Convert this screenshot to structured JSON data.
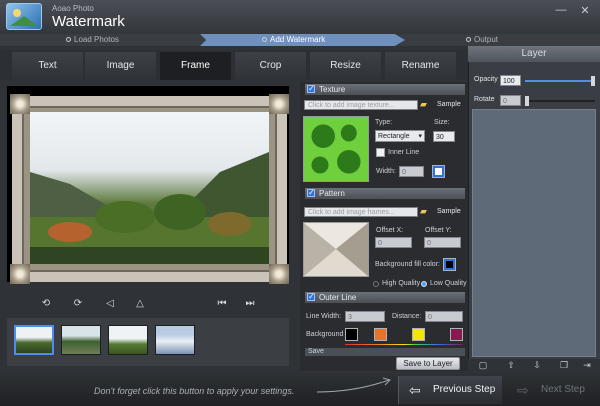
{
  "app": {
    "sub_title": "Aoao Photo",
    "title": "Watermark"
  },
  "window_controls": {
    "minimize": "—",
    "close": "✕"
  },
  "steps": [
    "Load Photos",
    "Add Watermark",
    "Output"
  ],
  "tabs": [
    "Text",
    "Image",
    "Frame",
    "Crop",
    "Resize",
    "Rename"
  ],
  "active_tab": "Frame",
  "preview_tools": {
    "rotate_left": "⟲",
    "rotate_right": "⟳",
    "flip_h": "◁",
    "flip_v": "△",
    "first": "⏮",
    "last": "⏭"
  },
  "texture": {
    "title": "Texture",
    "placeholder": "Click to add image texture...",
    "sample_label": "Sample",
    "type_label": "Type:",
    "type_value": "Rectangle",
    "size_label": "Size:",
    "size_value": "30",
    "inner_line_label": "Inner Line",
    "width_label": "Width:",
    "width_value": "0"
  },
  "pattern": {
    "title": "Pattern",
    "placeholder": "Click to add image frames...",
    "sample_label": "Sample",
    "offset_x_label": "Offset X:",
    "offset_x_value": "0",
    "offset_y_label": "Offset Y:",
    "offset_y_value": "0",
    "bg_fill_label": "Background fill color:",
    "high_quality_label": "High Quality",
    "low_quality_label": "Low Quality"
  },
  "outer_line": {
    "title": "Outer Line",
    "line_width_label": "Line Width:",
    "line_width_value": "3",
    "distance_label": "Distance:",
    "distance_value": "0",
    "background_label": "Background",
    "colors": [
      "#000000",
      "#e8742a",
      "#f3e50a",
      "#8a1a4e"
    ]
  },
  "save_section_label": "Save",
  "save_to_layer_label": "Save to Layer",
  "layer": {
    "title": "Layer",
    "opacity_label": "Opacity",
    "opacity_value": "100",
    "rotate_label": "Rotate",
    "rotate_value": "0",
    "opacity_level": 1.0,
    "rotate_level": 0.0
  },
  "layer_tools": [
    "new-layer-icon",
    "export-icon",
    "import-icon",
    "copy-icon",
    "undo-icon",
    "apply-icon"
  ],
  "bottom": {
    "hint": "Don't forget click this button to apply your settings.",
    "prev_label": "Previous Step",
    "next_label": "Next Step"
  },
  "colors": {
    "accent": "#6f90bd",
    "checkbox": "#2f73d8"
  }
}
